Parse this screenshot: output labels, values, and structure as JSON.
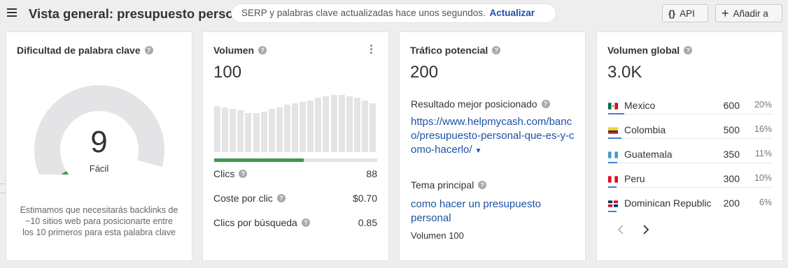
{
  "header": {
    "title": "Vista general: presupuesto personal",
    "serp_notice": "SERP y palabras clave actualizadas hace unos segundos.",
    "refresh_label": "Actualizar",
    "api_label": "API",
    "add_label": "Añadir a"
  },
  "kd": {
    "title": "Dificultad de palabra clave",
    "value": "9",
    "level": "Fácil",
    "score_fraction": 0.09,
    "note": "Estimamos que necesitarás backlinks de ~10 sitios web para posicionarte entre los 10 primeros para esta palabra clave"
  },
  "volume": {
    "title": "Volumen",
    "value": "100",
    "trend": [
      66,
      64,
      62,
      60,
      56,
      56,
      58,
      62,
      64,
      68,
      70,
      72,
      74,
      78,
      80,
      82,
      82,
      80,
      78,
      74,
      70
    ],
    "clicks_share": 0.55,
    "metrics": [
      {
        "label": "Clics",
        "value": "88"
      },
      {
        "label": "Coste por clic",
        "value": "$0.70"
      },
      {
        "label": "Clics por búsqueda",
        "value": "0.85"
      }
    ]
  },
  "traffic": {
    "title": "Tráfico potencial",
    "value": "200",
    "top_result_label": "Resultado mejor posicionado",
    "top_result_url": "https://www.helpmycash.com/banco/presupuesto-personal-que-es-y-como-hacerlo/",
    "parent_topic_label": "Tema principal",
    "parent_topic": "como hacer un presupuesto personal",
    "parent_topic_volume": "Volumen 100"
  },
  "global_volume": {
    "title": "Volumen global",
    "value": "3.0K",
    "countries": [
      {
        "name": "Mexico",
        "volume": "600",
        "pct": "20%",
        "share": 0.2,
        "flag": "flag-mexico-icon"
      },
      {
        "name": "Colombia",
        "volume": "500",
        "pct": "16%",
        "share": 0.16,
        "flag": "flag-colombia-icon"
      },
      {
        "name": "Guatemala",
        "volume": "350",
        "pct": "11%",
        "share": 0.11,
        "flag": "flag-guatemala-icon"
      },
      {
        "name": "Peru",
        "volume": "300",
        "pct": "10%",
        "share": 0.1,
        "flag": "flag-peru-icon"
      },
      {
        "name": "Dominican Republic",
        "volume": "200",
        "pct": "6%",
        "share": 0.06,
        "flag": "flag-dominican-republic-icon"
      }
    ]
  },
  "colors": {
    "accent_link": "#1c51a6",
    "kd_easy": "#3e9850",
    "share_bar": "#3f7ed8",
    "gauge_track": "#e4e4e6"
  }
}
